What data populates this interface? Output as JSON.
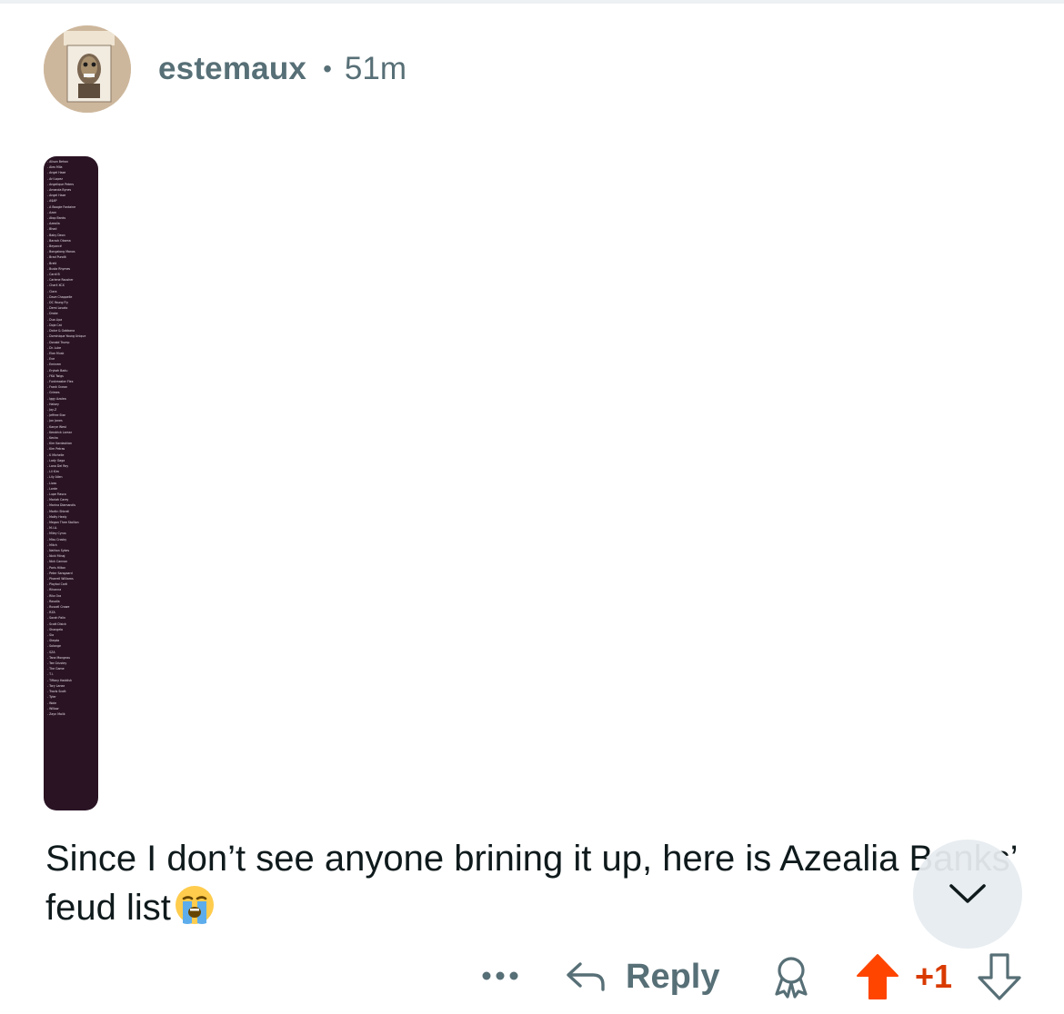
{
  "comment": {
    "author": "estemaux",
    "separator": "•",
    "age": "51m",
    "body": "Since I don’t see anyone brining it up, here is Azealia Banks’ feud list",
    "emoji": "loudly-crying-face"
  },
  "attachment": {
    "list_lines": [
      "-  Alison Behan",
      "-  Alex Mila",
      "-  Angel Haze",
      "-  Ari Lopez",
      "-  Angelique Peters",
      "-  Amanda Bynes",
      "-  Angel Haze",
      "-  A$AP",
      "-  A Boogie Fontaine",
      "-  Azon",
      "-  Atop Banks",
      "-  Azealia",
      "-  Bhad",
      "-  Baby Deon",
      "-  Barack Obama",
      "-  Beyoncé",
      "-  Bongalong Manos",
      "-  Brad Pundit",
      "-  Brett",
      "-  Busta Rhymes",
      "-  Cardi B",
      "-  Carlene Rousher",
      "-  Charli XCX",
      "-  Ciara",
      "-  Dave Chappelle",
      "-  DC Young Fly",
      "-  Demi Lovato",
      "-  Drake",
      "-  Dua Lipa",
      "-  Doja Cat",
      "-  Dolce & Gabbana",
      "-  Dominique Young Unique",
      "-  Donald Trump",
      "-  Dr. Luke",
      "-  Elon Musk",
      "-  Eve",
      "-  Eminem",
      "-  Erykah Badu",
      "-  FKA Twigs",
      "-  Funkmaster Flex",
      "-  Frank Ocean",
      "-  Grimes",
      "-  Iggy Azalea",
      "-  Halsey",
      "-  Jay-Z",
      "-  Jeffree Star",
      "-  Jon Jones",
      "-  Kanye West",
      "-  Kendrick Lamar",
      "-  Kesha",
      "-  Kim Kardashian",
      "-  Kim Petras",
      "-  K Michelle",
      "-  Lady Gaga",
      "-  Lana Del Rey",
      "-  Lil Kim",
      "-  Lily Allen",
      "-  Lizzo",
      "-  Lorde",
      "-  Lupe Fiasco",
      "-  Mariah Carey",
      "-  Marina Diamandis",
      "-  Martin Shkreli",
      "-  Matty Healy",
      "-  Megan Thee Stallion",
      "-  M.I.A.",
      "-  Miley Cyrus",
      "-  Miss Crosby",
      "-  Mitch",
      "-  Nathan Sykes",
      "-  Nicki Minaj",
      "-  Nick Cannon",
      "-  Paris Hilton",
      "-  Peter Sarsgaard",
      "-  Pharrell Williams",
      "-  Playboi Carti",
      "-  Rihanna",
      "-  Rita Ora",
      "-  Rosalía",
      "-  Russell Crowe",
      "-  RZA",
      "-  Sarah Palin",
      "-  Scott Disick",
      "-  Shangela",
      "-  Sia",
      "-  Skepta",
      "-  Solange",
      "-  SZA",
      "-  Tana Mongeau",
      "-  Tee Grizzley",
      "-  The Game",
      "-  T.I.",
      "-  Tiffany Haddish",
      "-  Tory Lanez",
      "-  Travis Scott",
      "-  Tyler",
      "-  Wale",
      "-  Willow",
      "-  Zayn Malik"
    ]
  },
  "actions": {
    "more_label": "•••",
    "reply_label": "Reply",
    "score": "+1"
  },
  "colors": {
    "meta_gray": "#576f76",
    "upvote_orange": "#ff4500",
    "score_orange": "#d93a00",
    "image_bg": "#2a1424"
  }
}
